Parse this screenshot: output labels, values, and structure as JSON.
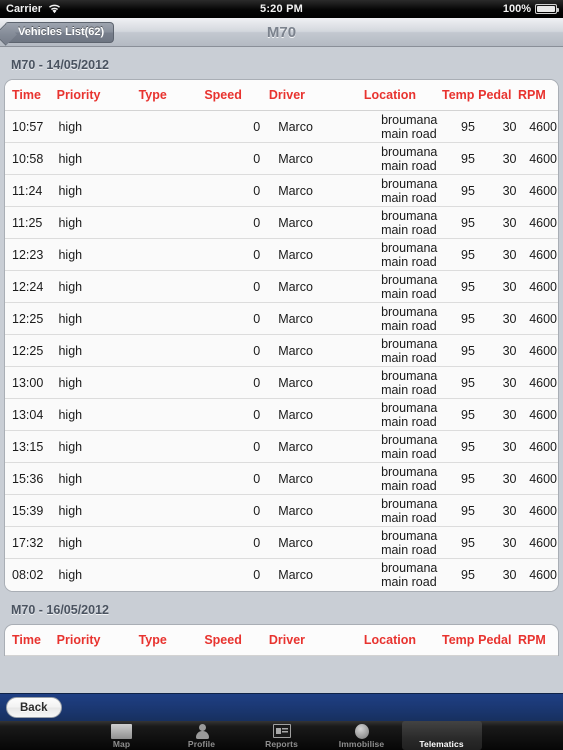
{
  "statusbar": {
    "carrier": "Carrier",
    "time": "5:20 PM",
    "battery_pct": "100%",
    "wifi_icon": "wifi-icon",
    "battery_icon": "battery-icon"
  },
  "navbar": {
    "back_label": "Vehicles List(62)",
    "title": "M70"
  },
  "columns": {
    "time": "Time",
    "priority": "Priority",
    "type": "Type",
    "speed": "Speed",
    "driver": "Driver",
    "location": "Location",
    "temp": "Temp",
    "pedal": "Pedal",
    "rpm": "RPM"
  },
  "colors": {
    "header_red": "#e8332f",
    "toolbar_blue": "#1b3873",
    "section_text": "#4a5360"
  },
  "sections": [
    {
      "title": "M70 - 14/05/2012",
      "rows": [
        {
          "time": "10:57",
          "priority": "high",
          "type": "",
          "speed": "0",
          "driver": "Marco",
          "location": "broumana main road",
          "temp": "95",
          "pedal": "30",
          "rpm": "4600"
        },
        {
          "time": "10:58",
          "priority": "high",
          "type": "",
          "speed": "0",
          "driver": "Marco",
          "location": "broumana main road",
          "temp": "95",
          "pedal": "30",
          "rpm": "4600"
        },
        {
          "time": "11:24",
          "priority": "high",
          "type": "",
          "speed": "0",
          "driver": "Marco",
          "location": "broumana main road",
          "temp": "95",
          "pedal": "30",
          "rpm": "4600"
        },
        {
          "time": "11:25",
          "priority": "high",
          "type": "",
          "speed": "0",
          "driver": "Marco",
          "location": "broumana main road",
          "temp": "95",
          "pedal": "30",
          "rpm": "4600"
        },
        {
          "time": "12:23",
          "priority": "high",
          "type": "",
          "speed": "0",
          "driver": "Marco",
          "location": "broumana main road",
          "temp": "95",
          "pedal": "30",
          "rpm": "4600"
        },
        {
          "time": "12:24",
          "priority": "high",
          "type": "",
          "speed": "0",
          "driver": "Marco",
          "location": "broumana main road",
          "temp": "95",
          "pedal": "30",
          "rpm": "4600"
        },
        {
          "time": "12:25",
          "priority": "high",
          "type": "",
          "speed": "0",
          "driver": "Marco",
          "location": "broumana main road",
          "temp": "95",
          "pedal": "30",
          "rpm": "4600"
        },
        {
          "time": "12:25",
          "priority": "high",
          "type": "",
          "speed": "0",
          "driver": "Marco",
          "location": "broumana main road",
          "temp": "95",
          "pedal": "30",
          "rpm": "4600"
        },
        {
          "time": "13:00",
          "priority": "high",
          "type": "",
          "speed": "0",
          "driver": "Marco",
          "location": "broumana main road",
          "temp": "95",
          "pedal": "30",
          "rpm": "4600"
        },
        {
          "time": "13:04",
          "priority": "high",
          "type": "",
          "speed": "0",
          "driver": "Marco",
          "location": "broumana main road",
          "temp": "95",
          "pedal": "30",
          "rpm": "4600"
        },
        {
          "time": "13:15",
          "priority": "high",
          "type": "",
          "speed": "0",
          "driver": "Marco",
          "location": "broumana main road",
          "temp": "95",
          "pedal": "30",
          "rpm": "4600"
        },
        {
          "time": "15:36",
          "priority": "high",
          "type": "",
          "speed": "0",
          "driver": "Marco",
          "location": "broumana main road",
          "temp": "95",
          "pedal": "30",
          "rpm": "4600"
        },
        {
          "time": "15:39",
          "priority": "high",
          "type": "",
          "speed": "0",
          "driver": "Marco",
          "location": "broumana main road",
          "temp": "95",
          "pedal": "30",
          "rpm": "4600"
        },
        {
          "time": "17:32",
          "priority": "high",
          "type": "",
          "speed": "0",
          "driver": "Marco",
          "location": "broumana main road",
          "temp": "95",
          "pedal": "30",
          "rpm": "4600"
        },
        {
          "time": "08:02",
          "priority": "high",
          "type": "",
          "speed": "0",
          "driver": "Marco",
          "location": "broumana main road",
          "temp": "95",
          "pedal": "30",
          "rpm": "4600"
        }
      ]
    },
    {
      "title": "M70 - 16/05/2012",
      "rows": []
    }
  ],
  "toolbar": {
    "back_label": "Back"
  },
  "tabbar": {
    "items": [
      {
        "label": "Map",
        "icon": "map-icon",
        "selected": false
      },
      {
        "label": "Profile",
        "icon": "person-icon",
        "selected": false
      },
      {
        "label": "Reports",
        "icon": "reports-icon",
        "selected": false
      },
      {
        "label": "Immobilise",
        "icon": "circle-icon",
        "selected": false
      },
      {
        "label": "Telematics",
        "icon": "telematics-icon",
        "selected": true
      }
    ]
  }
}
